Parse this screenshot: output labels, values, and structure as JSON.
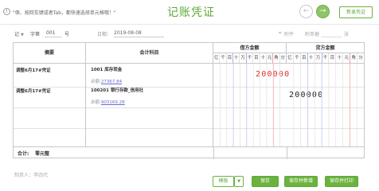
{
  "header": {
    "tip_icon": "!",
    "tip_text": "\"保、按回车键或者Tab，都快速选择单元格哦！\"",
    "title": "记账凭证",
    "prev_icon": "←",
    "next_icon": "→",
    "new_voucher_label": "新录凭证"
  },
  "toolbar": {
    "voucher_word": "记",
    "word_caret": "▼",
    "number_label": "字第",
    "number_value": "001",
    "number_suffix": "号",
    "date_label": "日期：",
    "date_value": "2019-08-08",
    "date_icon": "calendar-icon",
    "attachment_icon": "paperclip-icon",
    "attachment_label": "附件",
    "attachment_count_label": "附单据",
    "attachment_unit": "张"
  },
  "table": {
    "headers": {
      "summary": "摘要",
      "account": "会计科目",
      "debit": "借方金额",
      "credit": "贷方金额"
    },
    "units": [
      "亿",
      "千",
      "百",
      "十",
      "万",
      "千",
      "百",
      "十",
      "元",
      "角",
      "分"
    ],
    "rows": [
      {
        "summary": "调整6月17#凭证",
        "account": "1001 库存现金",
        "balance_label": "余额:",
        "balance": "27367.84",
        "debit": "200000",
        "credit": ""
      },
      {
        "summary": "调整6月17#凭证",
        "account": "100201 银行存款_信用社",
        "balance_label": "余额:",
        "balance": "903169.28",
        "debit": "",
        "credit": "200000"
      }
    ],
    "total_label": "合计:",
    "total_value": "零元整"
  },
  "footer": {
    "maker_label": "制单人：",
    "maker_name": "李四代",
    "template_label": "模板",
    "template_caret": "▼",
    "save_label": "保存",
    "save_new_label": "保存并新增",
    "save_print_label": "保存并打印"
  },
  "colors": {
    "accent": "#6cb23f",
    "debit_amount": "#d33333",
    "balance_link": "#6a6acf"
  }
}
